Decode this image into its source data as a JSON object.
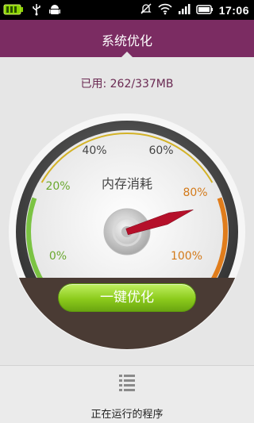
{
  "status_bar": {
    "time": "17:06",
    "icons": [
      "battery-charging-icon",
      "usb-icon",
      "android-icon",
      "muted-icon",
      "wifi-icon",
      "signal-icon",
      "battery-icon"
    ]
  },
  "header": {
    "title": "系统优化"
  },
  "memory": {
    "usage_text": "已用: 262/337MB",
    "used_mb": 262,
    "total_mb": 337
  },
  "gauge": {
    "label": "内存消耗",
    "ticks": [
      "0%",
      "20%",
      "40%",
      "60%",
      "80%",
      "100%"
    ],
    "needle_percent": 78,
    "colors": {
      "green": "#7bc343",
      "yellow": "#d3b226",
      "orange": "#e07d1c",
      "needle": "#b5102a"
    }
  },
  "actions": {
    "optimize_label": "一键优化"
  },
  "footer": {
    "running_programs_label": "正在运行的程序"
  }
}
